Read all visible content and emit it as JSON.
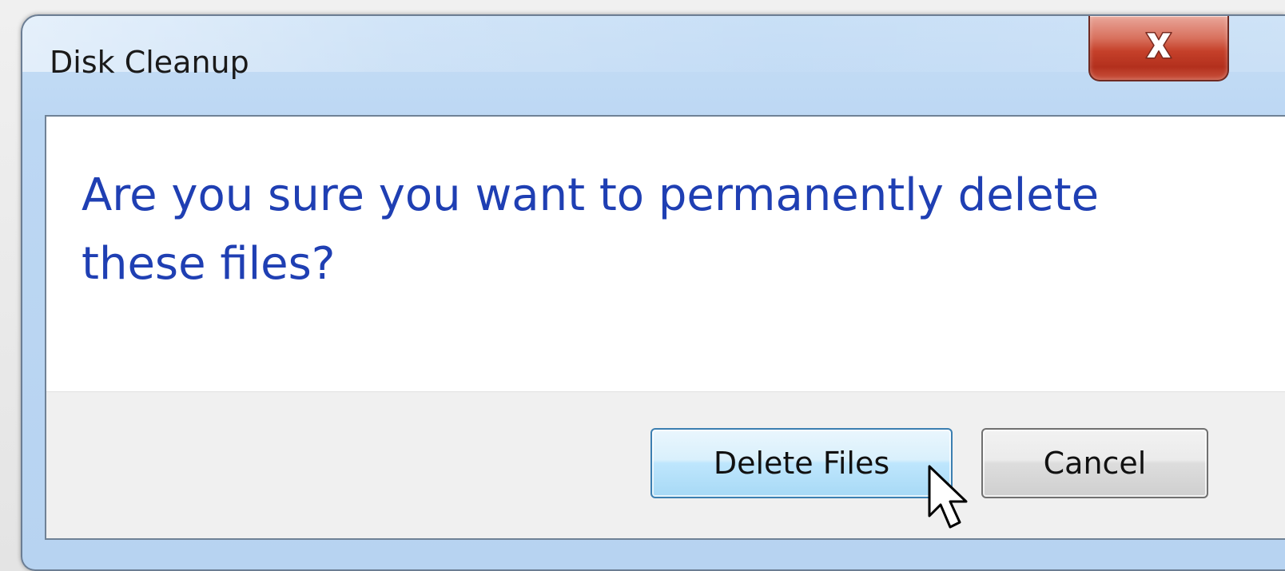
{
  "window": {
    "title": "Disk Cleanup",
    "close_icon": "close-icon"
  },
  "dialog": {
    "message": "Are you sure you want to permanently delete these files?"
  },
  "buttons": {
    "delete_label": "Delete Files",
    "cancel_label": "Cancel"
  },
  "colors": {
    "message_text": "#1f3fb3",
    "close_button": "#c5402a",
    "default_button_border": "#3c7fb1",
    "title_bar": "#bcd7f3"
  },
  "cursor_icon": "pointer-arrow-icon"
}
